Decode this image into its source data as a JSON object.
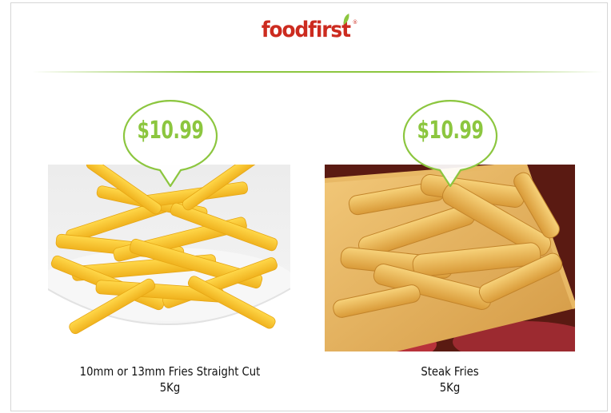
{
  "brand": {
    "logo_text": "foodfirst",
    "reg_mark": "®",
    "colors": {
      "brand_red": "#cc2b1f",
      "leaf_green": "#8cc63f"
    }
  },
  "products": [
    {
      "price": "$10.99",
      "name": "10mm or 13mm Fries Straight Cut",
      "size": "5Kg",
      "image": "straight-cut-fries-bowl"
    },
    {
      "price": "$10.99",
      "name": "Steak Fries",
      "size": "5Kg",
      "image": "steak-fries-board"
    }
  ],
  "colors": {
    "price_green": "#8cc63f",
    "divider": "#8cc63f"
  }
}
